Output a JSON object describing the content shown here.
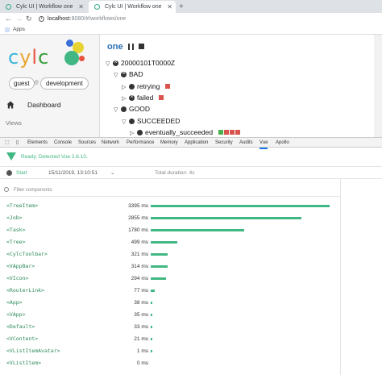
{
  "browser": {
    "tabs": [
      {
        "title": "Cylc UI | Workflow one",
        "active": false
      },
      {
        "title": "Cylc UI | Workflow one",
        "active": true
      }
    ],
    "new_tab": "+",
    "url_host": "localhost",
    "url_rest": ":8080/#/workflows/one",
    "bookmarks": {
      "apps_label": "Apps"
    }
  },
  "sidebar": {
    "logo_text": {
      "c1": "c",
      "y": "y",
      "l": "l",
      "c2": "c"
    },
    "user": "guest",
    "at": "@",
    "environment": "development",
    "nav_dashboard": "Dashboard",
    "views_label": "Views"
  },
  "workflow": {
    "name": "one",
    "tree": [
      {
        "toggle": "▽",
        "icon": "x",
        "label": "20000101T0000Z",
        "indent": 0
      },
      {
        "toggle": "▽",
        "icon": "x",
        "label": "BAD",
        "indent": 1
      },
      {
        "toggle": "▷",
        "icon": "dot",
        "label": "retrying",
        "indent": 2,
        "jobs": [
          "red"
        ]
      },
      {
        "toggle": "▷",
        "icon": "x",
        "label": "failed",
        "indent": 2,
        "jobs": [
          "red"
        ]
      },
      {
        "toggle": "▽",
        "icon": "dot",
        "label": "GOOD",
        "indent": 1
      },
      {
        "toggle": "▽",
        "icon": "dot",
        "label": "SUCCEEDED",
        "indent": 2
      },
      {
        "toggle": "▷",
        "icon": "dot",
        "label": "eventually_succeeded",
        "indent": 3,
        "jobs": [
          "green",
          "red",
          "red",
          "red"
        ]
      }
    ]
  },
  "devtools": {
    "tabs": [
      "Elements",
      "Console",
      "Sources",
      "Network",
      "Performance",
      "Memory",
      "Application",
      "Security",
      "Audits",
      "Vue",
      "Apollo"
    ],
    "active_tab": "Vue",
    "vue_status": "Ready. Detected Vue 2.6.10.",
    "timeline": {
      "start_label": "Start",
      "datetime": "15/11/2019, 13:10:51",
      "total_duration": "Total duration: 4s"
    },
    "filter_placeholder": "Filter components",
    "components": [
      {
        "name": "<TreeItem>",
        "time": "3395 ms",
        "ms": 3395
      },
      {
        "name": "<Job>",
        "time": "2855 ms",
        "ms": 2855
      },
      {
        "name": "<Task>",
        "time": "1780 ms",
        "ms": 1780
      },
      {
        "name": "<Tree>",
        "time": "499 ms",
        "ms": 499
      },
      {
        "name": "<CylcToolbar>",
        "time": "321 ms",
        "ms": 321
      },
      {
        "name": "<VAppBar>",
        "time": "314 ms",
        "ms": 314
      },
      {
        "name": "<VIcon>",
        "time": "294 ms",
        "ms": 294
      },
      {
        "name": "<RouterLink>",
        "time": "77 ms",
        "ms": 77
      },
      {
        "name": "<App>",
        "time": "38 ms",
        "ms": 38
      },
      {
        "name": "<VApp>",
        "time": "35 ms",
        "ms": 35
      },
      {
        "name": "<Default>",
        "time": "33 ms",
        "ms": 33
      },
      {
        "name": "<VContent>",
        "time": "21 ms",
        "ms": 21
      },
      {
        "name": "<VListItemAvatar>",
        "time": "1 ms",
        "ms": 1
      },
      {
        "name": "<VListItem>",
        "time": "0 ms",
        "ms": 0
      }
    ]
  },
  "colors": {
    "vue_green": "#41b883",
    "job_failed": "#d9534f",
    "job_succeeded": "#4cae4c",
    "accent_blue": "#2a72b5"
  }
}
